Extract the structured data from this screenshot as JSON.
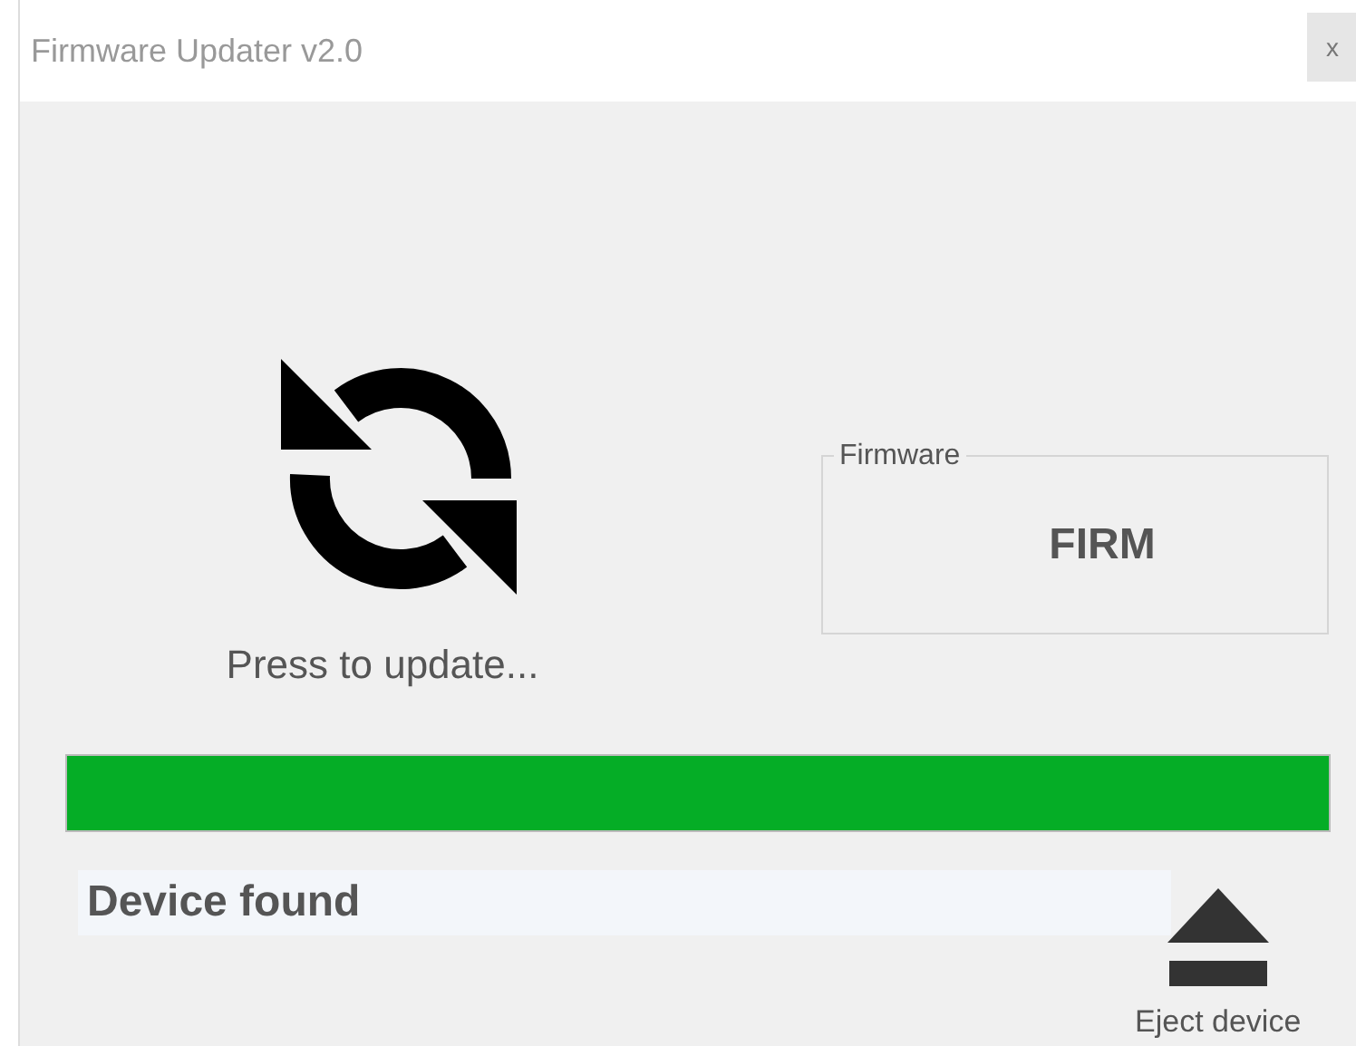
{
  "window": {
    "title": "Firmware Updater v2.0",
    "close": "x"
  },
  "update": {
    "label": "Press to update..."
  },
  "firmware": {
    "legend": "Firmware",
    "value": "FIRM"
  },
  "progress": {
    "level": 1
  },
  "status": {
    "text": "Device found"
  },
  "eject": {
    "label": "Eject device"
  }
}
